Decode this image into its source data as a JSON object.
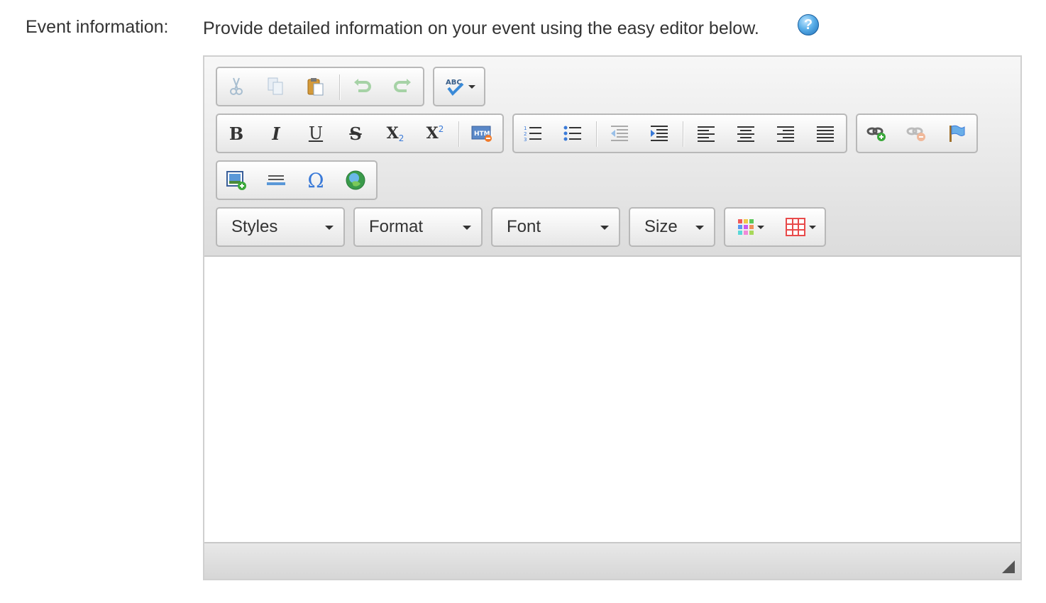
{
  "field": {
    "label": "Event information:",
    "description": "Provide detailed information on your event using the easy editor below.",
    "help_icon": "help-icon"
  },
  "editor": {
    "toolbar_row1": {
      "clipboard": [
        "cut-icon",
        "copy-icon",
        "paste-icon",
        "undo-icon",
        "redo-icon"
      ],
      "spellcheck": [
        "spellcheck-icon"
      ]
    },
    "toolbar_row2": {
      "formatting": {
        "bold": "B",
        "italic": "I",
        "underline": "U",
        "strike": "S",
        "subscript": "X",
        "subscript_small": "2",
        "superscript": "X",
        "superscript_small": "2"
      },
      "html": "HTML",
      "lists": [
        "numbered-list-icon",
        "bulleted-list-icon",
        "outdent-icon",
        "indent-icon",
        "align-left-icon",
        "align-center-icon",
        "align-right-icon",
        "justify-icon"
      ],
      "links": [
        "link-icon",
        "unlink-icon",
        "anchor-icon"
      ]
    },
    "toolbar_row3": {
      "insert": [
        "image-icon",
        "horizontal-rule-icon",
        "special-char-icon",
        "flash-icon"
      ],
      "special_char_glyph": "Ω"
    },
    "toolbar_row4": {
      "styles": "Styles",
      "format": "Format",
      "font": "Font",
      "size": "Size",
      "color_icons": [
        "text-color-icon",
        "table-icon"
      ]
    },
    "content": ""
  }
}
